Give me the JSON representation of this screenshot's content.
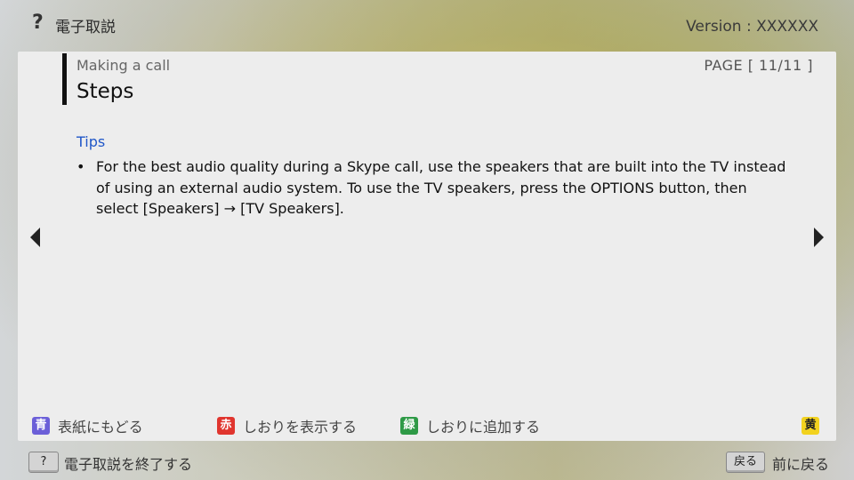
{
  "header": {
    "help_glyph": "?",
    "title": "電子取説",
    "version": "Version : XXXXXX"
  },
  "page": {
    "section": "Making a call",
    "title": "Steps",
    "page_indicator": "PAGE [ 11/11 ]",
    "tips_heading": "Tips",
    "bullet": "•",
    "tip_text": "For the best audio quality during a Skype call, use the speakers that are built into the TV instead of using an external audio system. To use the TV speakers, press the OPTIONS button, then select [Speakers] → [TV Speakers]."
  },
  "color_keys": [
    {
      "key": "青",
      "label": "表紙にもどる",
      "color": "#6b5fd8"
    },
    {
      "key": "赤",
      "label": "しおりを表示する",
      "color": "#e0352e"
    },
    {
      "key": "緑",
      "label": "しおりに追加する",
      "color": "#2e9a46"
    },
    {
      "key": "黄",
      "label": "",
      "color": "#f2d21e"
    }
  ],
  "footer": {
    "help_key": "?",
    "exit_label": "電子取説を終了する",
    "back_key": "戻る",
    "back_label": "前に戻る"
  },
  "icons": {
    "nav_left": "triangle-left-icon",
    "nav_right": "triangle-right-icon"
  }
}
